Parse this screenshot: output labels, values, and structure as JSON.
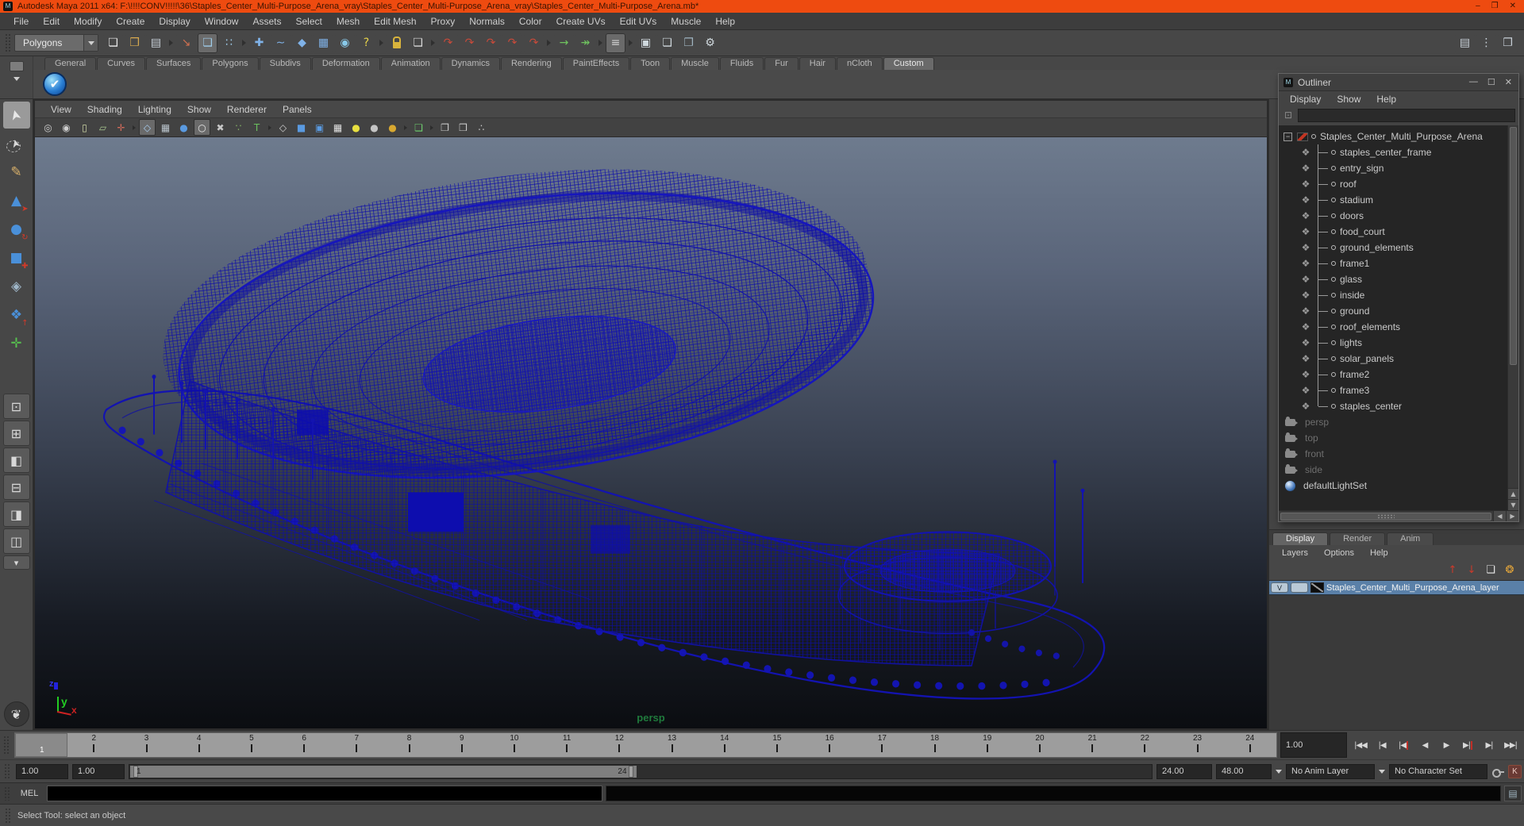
{
  "window": {
    "title": "Autodesk Maya 2011 x64: F:\\!!!!CONV!!!!!\\36\\Staples_Center_Multi-Purpose_Arena_vray\\Staples_Center_Multi-Purpose_Arena_vray\\Staples_Center_Multi-Purpose_Arena.mb*",
    "controls": {
      "minimize": "–",
      "maximize": "❐",
      "close": "✕"
    }
  },
  "colors": {
    "titlebar_accent": "#ee4b10",
    "selection_highlight": "#5a80a8",
    "wireframe": "#1111ae",
    "persp_label_green": "#1f7a3c",
    "viewport_gradient_top": "#6e7b8e",
    "viewport_gradient_bottom": "#0b0d11"
  },
  "menubar": {
    "items": [
      "File",
      "Edit",
      "Modify",
      "Create",
      "Display",
      "Window",
      "Assets",
      "Select",
      "Mesh",
      "Edit Mesh",
      "Proxy",
      "Normals",
      "Color",
      "Create UVs",
      "Edit UVs",
      "Muscle",
      "Help"
    ]
  },
  "statusline": {
    "mode_selector": "Polygons",
    "icons": [
      {
        "name": "new-scene-icon",
        "glyph": "❏",
        "color": "#e8e8e8",
        "kind": "",
        "inter": "true"
      },
      {
        "name": "open-scene-icon",
        "glyph": "❒",
        "color": "#d7a94f",
        "kind": "",
        "inter": "true"
      },
      {
        "name": "save-scene-icon",
        "glyph": "▤",
        "color": "#c8d0d8",
        "kind": "",
        "inter": "true"
      },
      {
        "name": "separator",
        "glyph": "",
        "color": "",
        "kind": "sep",
        "inter": "false"
      },
      {
        "name": "select-hierarchy-icon",
        "glyph": "↘",
        "color": "#d07050",
        "kind": "",
        "inter": "true"
      },
      {
        "name": "select-object-icon",
        "glyph": "❏",
        "color": "#9ecbe8",
        "kind": "active",
        "inter": "true"
      },
      {
        "name": "select-component-icon",
        "glyph": "∷",
        "color": "#9ecbe8",
        "kind": "",
        "inter": "true"
      },
      {
        "name": "separator",
        "glyph": "",
        "color": "",
        "kind": "sep",
        "inter": "false"
      },
      {
        "name": "snap-to-grids-icon",
        "glyph": "✚",
        "color": "#7fb2e8",
        "kind": "",
        "inter": "true"
      },
      {
        "name": "snap-to-curves-icon",
        "glyph": "∼",
        "color": "#7fb2e8",
        "kind": "",
        "inter": "true"
      },
      {
        "name": "snap-to-points-icon",
        "glyph": "◆",
        "color": "#7fb2e8",
        "kind": "",
        "inter": "true"
      },
      {
        "name": "snap-to-view-planes-icon",
        "glyph": "▦",
        "color": "#7fb2e8",
        "kind": "",
        "inter": "true"
      },
      {
        "name": "make-live-icon",
        "glyph": "◉",
        "color": "#88c8e8",
        "kind": "",
        "inter": "true"
      },
      {
        "name": "snap-options-icon",
        "glyph": "?",
        "color": "#e8d44a",
        "kind": "",
        "inter": "true"
      },
      {
        "name": "separator",
        "glyph": "",
        "color": "",
        "kind": "sep",
        "inter": "false"
      },
      {
        "name": "lock-selection-icon",
        "glyph": "",
        "color": "",
        "kind": "lock",
        "inter": "true"
      },
      {
        "name": "highlight-selection-icon",
        "glyph": "❏",
        "color": "#d8d8d8",
        "kind": "",
        "inter": "true"
      },
      {
        "name": "separator",
        "glyph": "",
        "color": "",
        "kind": "sep",
        "inter": "false"
      },
      {
        "name": "input-to-selected-icon",
        "glyph": "↷",
        "color": "#c84a3a",
        "kind": "",
        "inter": "true"
      },
      {
        "name": "output-from-selected-icon",
        "glyph": "↷",
        "color": "#c84a3a",
        "kind": "",
        "inter": "true"
      },
      {
        "name": "node-connections-icon",
        "glyph": "↷",
        "color": "#c84a3a",
        "kind": "",
        "inter": "true"
      },
      {
        "name": "construction-history-on-icon",
        "glyph": "↷",
        "color": "#c84a3a",
        "kind": "",
        "inter": "true"
      },
      {
        "name": "construction-history-off-icon",
        "glyph": "↷",
        "color": "#c84a3a",
        "kind": "",
        "inter": "true"
      },
      {
        "name": "separator",
        "glyph": "",
        "color": "",
        "kind": "sep",
        "inter": "false"
      },
      {
        "name": "transfer-in-icon",
        "glyph": "→",
        "color": "#6fc45f",
        "kind": "",
        "inter": "true"
      },
      {
        "name": "transfer-out-icon",
        "glyph": "↠",
        "color": "#6fc45f",
        "kind": "",
        "inter": "true"
      },
      {
        "name": "separator",
        "glyph": "",
        "color": "",
        "kind": "sep",
        "inter": "false"
      },
      {
        "name": "numeric-input-icon",
        "glyph": "≡",
        "color": "#d0d0d0",
        "kind": "active",
        "inter": "true"
      },
      {
        "name": "separator",
        "glyph": "",
        "color": "",
        "kind": "sep",
        "inter": "false"
      },
      {
        "name": "render-view-icon",
        "glyph": "▣",
        "color": "#cfd8dd",
        "kind": "",
        "inter": "true"
      },
      {
        "name": "render-current-frame-icon",
        "glyph": "❏",
        "color": "#cfd8dd",
        "kind": "",
        "inter": "true"
      },
      {
        "name": "ipr-render-icon",
        "glyph": "❐",
        "color": "#9fb4c0",
        "kind": "",
        "inter": "true"
      },
      {
        "name": "render-settings-icon",
        "glyph": "⚙",
        "color": "#cfd8dd",
        "kind": "",
        "inter": "true"
      }
    ],
    "sidebar_icons": [
      {
        "name": "attribute-editor-toggle-icon",
        "glyph": "▤",
        "color": "#c8d0d8",
        "kind": "",
        "inter": "true"
      },
      {
        "name": "tool-settings-toggle-icon",
        "glyph": "⋮",
        "color": "#c8d0d8",
        "kind": "",
        "inter": "true"
      },
      {
        "name": "channel-box-toggle-icon",
        "glyph": "❐",
        "color": "#c8d0d8",
        "kind": "",
        "inter": "true"
      }
    ]
  },
  "shelf": {
    "tabs": [
      {
        "label": "General",
        "state": ""
      },
      {
        "label": "Curves",
        "state": ""
      },
      {
        "label": "Surfaces",
        "state": ""
      },
      {
        "label": "Polygons",
        "state": ""
      },
      {
        "label": "Subdivs",
        "state": ""
      },
      {
        "label": "Deformation",
        "state": ""
      },
      {
        "label": "Animation",
        "state": ""
      },
      {
        "label": "Dynamics",
        "state": ""
      },
      {
        "label": "Rendering",
        "state": ""
      },
      {
        "label": "PaintEffects",
        "state": ""
      },
      {
        "label": "Toon",
        "state": ""
      },
      {
        "label": "Muscle",
        "state": ""
      },
      {
        "label": "Fluids",
        "state": ""
      },
      {
        "label": "Fur",
        "state": ""
      },
      {
        "label": "Hair",
        "state": ""
      },
      {
        "label": "nCloth",
        "state": ""
      },
      {
        "label": "Custom",
        "state": "active"
      }
    ],
    "items": [
      {
        "name": "custom-shelf-check-button",
        "glyph": "✔"
      }
    ]
  },
  "toolbox": {
    "tools": [
      {
        "name": "select-tool",
        "glyph": "➤",
        "color": "#e8e8e8",
        "kind": "active",
        "sub": "",
        "subcolor": "",
        "inter": "true"
      },
      {
        "name": "lasso-select-tool",
        "glyph": "➤",
        "color": "#d8d8d8",
        "kind": "",
        "sub": "",
        "subcolor": "",
        "inter": "true"
      },
      {
        "name": "paint-select-tool",
        "glyph": "✎",
        "color": "#d8b06a",
        "kind": "",
        "sub": "",
        "subcolor": "",
        "inter": "true"
      },
      {
        "name": "move-tool",
        "glyph": "▲",
        "color": "#4a90d9",
        "kind": "",
        "sub": "➤",
        "subcolor": "#d03a2a",
        "inter": "true"
      },
      {
        "name": "rotate-tool",
        "glyph": "●",
        "color": "#4a90d9",
        "kind": "",
        "sub": "↻",
        "subcolor": "#d03a2a",
        "inter": "true"
      },
      {
        "name": "scale-tool",
        "glyph": "■",
        "color": "#4a90d9",
        "kind": "",
        "sub": "✚",
        "subcolor": "#d03a2a",
        "inter": "true"
      },
      {
        "name": "universal-manipulator-tool",
        "glyph": "◈",
        "color": "#9fb6c8",
        "kind": "",
        "sub": "",
        "subcolor": "",
        "inter": "true"
      },
      {
        "name": "soft-modification-tool",
        "glyph": "❖",
        "color": "#4a90d9",
        "kind": "",
        "sub": "↑",
        "subcolor": "#d03a2a",
        "inter": "true"
      },
      {
        "name": "show-manipulator-tool",
        "glyph": "✛",
        "color": "#57c44f",
        "kind": "",
        "sub": "",
        "subcolor": "",
        "inter": "true"
      },
      {
        "name": "last-tool-slot",
        "glyph": "",
        "color": "",
        "kind": "",
        "sub": "",
        "subcolor": "",
        "inter": "true"
      }
    ],
    "layouts": [
      {
        "name": "single-pane-layout-button",
        "glyph": "⊡",
        "kind": "",
        "inter": "true"
      },
      {
        "name": "four-pane-layout-button",
        "glyph": "⊞",
        "kind": "",
        "inter": "true"
      },
      {
        "name": "outliner-persp-layout-button",
        "glyph": "◧",
        "kind": "",
        "inter": "true"
      },
      {
        "name": "persp-graph-layout-button",
        "glyph": "⊟",
        "kind": "",
        "inter": "true"
      },
      {
        "name": "hypershade-persp-layout-button",
        "glyph": "◨",
        "kind": "",
        "inter": "true"
      },
      {
        "name": "persp-outliner-graph-layout-button",
        "glyph": "◫",
        "kind": "",
        "inter": "true"
      },
      {
        "name": "layout-dropdown-button",
        "glyph": "▾",
        "kind": "small",
        "inter": "true"
      }
    ],
    "dragon_glyph": "❦"
  },
  "viewport": {
    "menus": [
      "View",
      "Shading",
      "Lighting",
      "Show",
      "Renderer",
      "Panels"
    ],
    "icons": [
      {
        "name": "select-camera-icon",
        "glyph": "◎",
        "color": "#cfcfcf",
        "kind": "",
        "inter": "true"
      },
      {
        "name": "camera-attributes-icon",
        "glyph": "◉",
        "color": "#cfcfcf",
        "kind": "",
        "inter": "true"
      },
      {
        "name": "camera-bookmarks-icon",
        "glyph": "▯",
        "color": "#cfd8a8",
        "kind": "",
        "inter": "true"
      },
      {
        "name": "image-plane-icon",
        "glyph": "▱",
        "color": "#a8c890",
        "kind": "",
        "inter": "true"
      },
      {
        "name": "2d-pan-zoom-icon",
        "glyph": "✛",
        "color": "#d06a5a",
        "kind": "",
        "inter": "true"
      },
      {
        "name": "separator",
        "glyph": "",
        "color": "",
        "kind": "sep",
        "inter": "false"
      },
      {
        "name": "wireframe-mode-icon",
        "glyph": "◇",
        "color": "#a8cdf0",
        "kind": "active",
        "inter": "true"
      },
      {
        "name": "default-material-icon",
        "glyph": "▦",
        "color": "#b8c2ca",
        "kind": "",
        "inter": "true"
      },
      {
        "name": "smooth-shade-icon",
        "glyph": "●",
        "color": "#5a9ae0",
        "kind": "",
        "inter": "true"
      },
      {
        "name": "flat-shade-icon",
        "glyph": "○",
        "color": "#e8e8e8",
        "kind": "active",
        "inter": "true"
      },
      {
        "name": "xray-mode-icon",
        "glyph": "✖",
        "color": "#c8c8c8",
        "kind": "",
        "inter": "true"
      },
      {
        "name": "use-lighting-icon",
        "glyph": "∵",
        "color": "#88b868",
        "kind": "",
        "inter": "true"
      },
      {
        "name": "textured-mode-icon",
        "glyph": "T",
        "color": "#6abf5e",
        "kind": "",
        "inter": "true"
      },
      {
        "name": "separator",
        "glyph": "",
        "color": "",
        "kind": "sep",
        "inter": "false"
      },
      {
        "name": "wireframe-on-shaded-icon",
        "glyph": "◇",
        "color": "#d0d0d0",
        "kind": "",
        "inter": "true"
      },
      {
        "name": "shaded-cube-icon",
        "glyph": "■",
        "color": "#5a9ae0",
        "kind": "",
        "inter": "true"
      },
      {
        "name": "textured-cube-icon",
        "glyph": "▣",
        "color": "#5a9ae0",
        "kind": "",
        "inter": "true"
      },
      {
        "name": "use-default-material-icon",
        "glyph": "▦",
        "color": "#e0e0e0",
        "kind": "",
        "inter": "true"
      },
      {
        "name": "default-light-icon",
        "glyph": "●",
        "color": "#e8e040",
        "kind": "",
        "inter": "true"
      },
      {
        "name": "ambient-light-icon",
        "glyph": "●",
        "color": "#c4c4c4",
        "kind": "",
        "inter": "true"
      },
      {
        "name": "all-lights-icon",
        "glyph": "●",
        "color": "#d8a830",
        "kind": "",
        "inter": "true"
      },
      {
        "name": "separator",
        "glyph": "",
        "color": "",
        "kind": "sep",
        "inter": "false"
      },
      {
        "name": "marquee-select-icon",
        "glyph": "❏",
        "color": "#6fd46f",
        "kind": "",
        "inter": "true"
      },
      {
        "name": "separator",
        "glyph": "",
        "color": "",
        "kind": "sep",
        "inter": "false"
      },
      {
        "name": "isolate-select-icon",
        "glyph": "❐",
        "color": "#d0d0d0",
        "kind": "",
        "inter": "true"
      },
      {
        "name": "duplicate-pane-icon",
        "glyph": "❒",
        "color": "#d0d0d0",
        "kind": "",
        "inter": "true"
      },
      {
        "name": "share-view-icon",
        "glyph": "∴",
        "color": "#d0d0d0",
        "kind": "",
        "inter": "true"
      }
    ],
    "camera_label": "persp",
    "axis": {
      "x": "x",
      "y": "y",
      "z": "z"
    }
  },
  "outliner": {
    "title": "Outliner",
    "menus": [
      "Display",
      "Show",
      "Help"
    ],
    "expand_glyph": "−",
    "root": "Staples_Center_Multi_Purpose_Arena",
    "children": [
      "staples_center_frame",
      "entry_sign",
      "roof",
      "stadium",
      "doors",
      "food_court",
      "ground_elements",
      "frame1",
      "glass",
      "inside",
      "ground",
      "roof_elements",
      "lights",
      "solar_panels",
      "frame2",
      "frame3",
      "staples_center"
    ],
    "cameras": [
      "persp",
      "top",
      "front",
      "side"
    ],
    "light_set": "defaultLightSet",
    "controls": {
      "minimize": "—",
      "maximize": "☐",
      "close": "✕"
    },
    "scroll": {
      "up": "▲",
      "down": "▼",
      "left": "◀",
      "right": "▶"
    }
  },
  "layer_editor": {
    "tabs": [
      {
        "label": "Display",
        "state": "active"
      },
      {
        "label": "Render",
        "state": ""
      },
      {
        "label": "Anim",
        "state": ""
      }
    ],
    "menus": [
      "Layers",
      "Options",
      "Help"
    ],
    "icons": [
      {
        "name": "move-layer-up-icon",
        "glyph": "↑",
        "color": "#cc3a2a",
        "inter": "true"
      },
      {
        "name": "move-layer-down-icon",
        "glyph": "↓",
        "color": "#cc3a2a",
        "inter": "true"
      },
      {
        "name": "create-empty-layer-icon",
        "glyph": "❏",
        "color": "#e8e8e8",
        "inter": "true"
      },
      {
        "name": "create-layer-from-selected-icon",
        "glyph": "❂",
        "color": "#e8a83a",
        "inter": "true"
      }
    ],
    "layer": {
      "visible_label": "V",
      "name": "Staples_Center_Multi_Purpose_Arena_layer"
    }
  },
  "timeline": {
    "frames": [
      "1",
      "2",
      "3",
      "4",
      "5",
      "6",
      "7",
      "8",
      "9",
      "10",
      "11",
      "12",
      "13",
      "14",
      "15",
      "16",
      "17",
      "18",
      "19",
      "20",
      "21",
      "22",
      "23",
      "24"
    ],
    "current_frame": "1",
    "current_time": "1.00",
    "playback": [
      {
        "name": "go-to-start-button",
        "glyph": "|◀◀",
        "accent": ""
      },
      {
        "name": "step-back-frame-button",
        "glyph": "|◀",
        "accent": ""
      },
      {
        "name": "step-back-key-button",
        "glyph": "|◀",
        "accent": "true"
      },
      {
        "name": "play-backwards-button",
        "glyph": "◀",
        "accent": ""
      },
      {
        "name": "play-forwards-button",
        "glyph": "▶",
        "accent": ""
      },
      {
        "name": "step-forward-key-button",
        "glyph": "▶|",
        "accent": "true"
      },
      {
        "name": "step-forward-frame-button",
        "glyph": "▶|",
        "accent": ""
      },
      {
        "name": "go-to-end-button",
        "glyph": "▶▶|",
        "accent": ""
      }
    ]
  },
  "range_slider": {
    "anim_start": "1.00",
    "playback_start": "1.00",
    "range_start_label": "1",
    "range_end_label": "24",
    "playback_end": "24.00",
    "anim_end": "48.00",
    "anim_layer": "No Anim Layer",
    "character_set": "No Character Set"
  },
  "command_line": {
    "label": "MEL"
  },
  "help_line": {
    "text": "Select Tool: select an object"
  }
}
